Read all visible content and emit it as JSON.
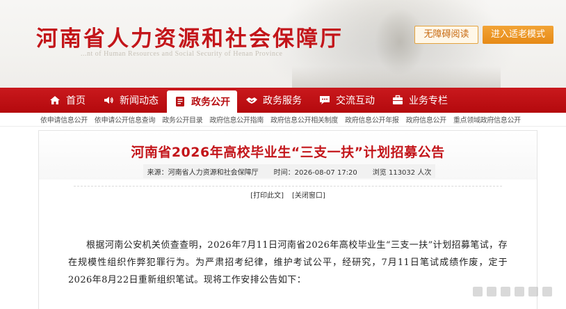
{
  "header": {
    "site_title": "河南省人力资源和社会保障厅",
    "site_subtitle": "...nt of Human Resources and Social Security of Henan Province",
    "accessibility_label": "无障碍阅读",
    "elder_mode_label": "进入适老模式"
  },
  "nav": {
    "items": [
      {
        "label": "首页",
        "icon": "home-icon"
      },
      {
        "label": "新闻动态",
        "icon": "speaker-icon"
      },
      {
        "label": "政务公开",
        "icon": "document-icon"
      },
      {
        "label": "政务服务",
        "icon": "handshake-icon"
      },
      {
        "label": "交流互动",
        "icon": "chat-icon"
      },
      {
        "label": "业务专栏",
        "icon": "briefcase-icon"
      }
    ],
    "active_index": 2
  },
  "subnav": {
    "items": [
      "依申请信息公开",
      "依申请公开信息查询",
      "政务公开目录",
      "政府信息公开指南",
      "政府信息公开相关制度",
      "政府信息公开年报",
      "政府信息公开",
      "重点领域政府信息公开"
    ]
  },
  "article": {
    "title": "河南省2026年高校毕业生“三支一扶”计划招募公告",
    "source": "来源：河南省人力资源和社会保障厅",
    "time": "时间：2026-08-07 17:20",
    "views": "浏览 113032 人次",
    "print_label": "[打印此文]",
    "close_label": "[关闭窗口]",
    "paragraph_1": "根据河南公安机关侦查查明，2026年7月11日河南省2026年高校毕业生“三支一扶”计划招募笔试，存在规模性组织作弊犯罪行为。为严肃招考纪律，维护考试公平，经研究，7月11日笔试成绩作废，定于2026年8月22日重新组织笔试。现将工作安排公告如下："
  },
  "colors": {
    "brand_red": "#c3151a",
    "nav_red": "#c9191d",
    "accent_orange": "#e68a16"
  }
}
